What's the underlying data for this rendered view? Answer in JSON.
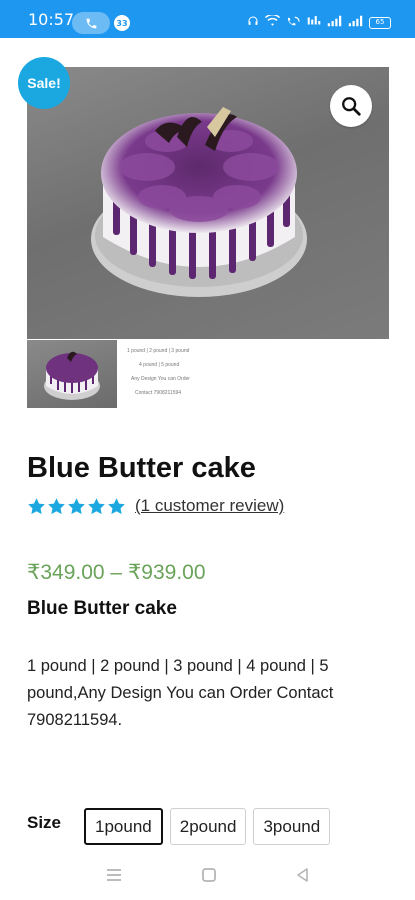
{
  "status_bar": {
    "time": "10:57",
    "notification_count": "33",
    "battery": "65",
    "accent_color": "#1e97f0"
  },
  "gallery": {
    "sale_badge": "Sale!",
    "zoom_icon": "search-icon",
    "thumbnail_text": [
      "1 pound | 2 pound | 3 pound",
      "4 pound | 5 pound",
      "Any Design You can Order",
      "Contact 7908211594"
    ]
  },
  "product": {
    "title": "Blue Butter cake",
    "rating": 5,
    "rating_max": 5,
    "review_link": "(1 customer review)",
    "price": "₹349.00 – ₹939.00",
    "subtitle": "Blue Butter cake",
    "description": "1 pound | 2 pound | 3 pound | 4 pound | 5 pound,Any Design You can Order Contact 7908211594."
  },
  "size": {
    "label": "Size",
    "options": [
      "1pound",
      "2pound",
      "3pound"
    ],
    "selected": "1pound"
  },
  "colors": {
    "sale": "#1ba8e0",
    "star": "#1ba8e0",
    "price": "#6aa35a"
  },
  "nav": {
    "icons": [
      "menu-icon",
      "home-icon",
      "back-icon"
    ]
  }
}
